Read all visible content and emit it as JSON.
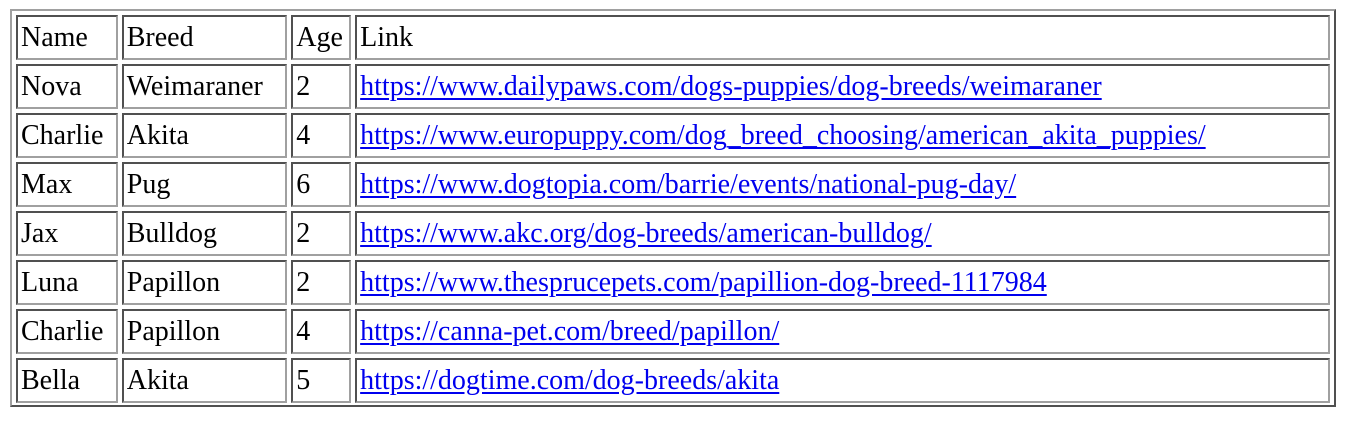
{
  "table": {
    "headers": [
      "Name",
      "Breed",
      "Age",
      "Link"
    ],
    "rows": [
      {
        "name": "Nova",
        "breed": "Weimaraner",
        "age": "2",
        "link": "https://www.dailypaws.com/dogs-puppies/dog-breeds/weimaraner"
      },
      {
        "name": "Charlie",
        "breed": "Akita",
        "age": "4",
        "link": "https://www.europuppy.com/dog_breed_choosing/american_akita_puppies/"
      },
      {
        "name": "Max",
        "breed": "Pug",
        "age": "6",
        "link": "https://www.dogtopia.com/barrie/events/national-pug-day/"
      },
      {
        "name": "Jax",
        "breed": "Bulldog",
        "age": "2",
        "link": "https://www.akc.org/dog-breeds/american-bulldog/"
      },
      {
        "name": "Luna",
        "breed": "Papillon",
        "age": "2",
        "link": "https://www.thesprucepets.com/papillion-dog-breed-1117984"
      },
      {
        "name": "Charlie",
        "breed": "Papillon",
        "age": "4",
        "link": "https://canna-pet.com/breed/papillon/"
      },
      {
        "name": "Bella",
        "breed": "Akita",
        "age": "5",
        "link": "https://dogtime.com/dog-breeds/akita"
      }
    ]
  },
  "colors": {
    "link": "#0000ee",
    "border_dark": "#505050",
    "border_light": "#a0a0a0",
    "background": "#ffffff"
  }
}
